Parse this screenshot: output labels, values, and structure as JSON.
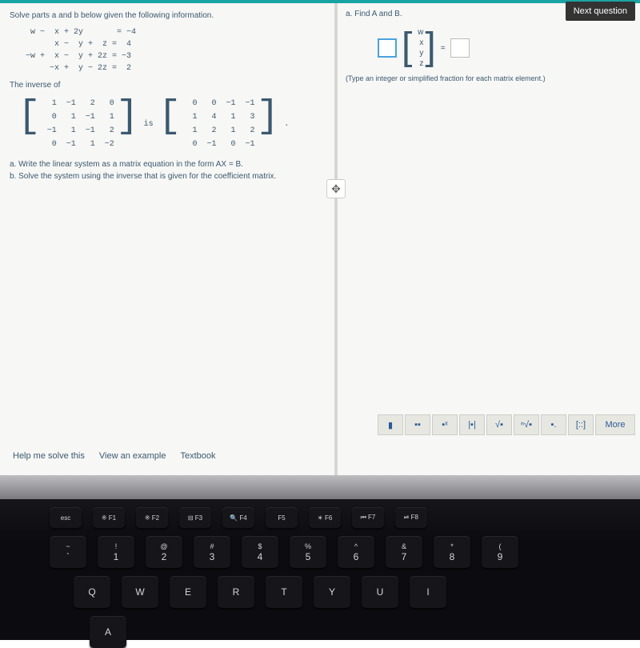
{
  "header": {
    "next": "Next question"
  },
  "left": {
    "intro": "Solve parts a and b below given the following information.",
    "equations": " w −  x + 2y       = −4\n      x −  y +  z =  4\n−w +  x −  y + 2z = −3\n     −x +  y − 2z =  2",
    "inverse_label": "The inverse of",
    "is_label": "is",
    "matrixA": [
      [
        "1",
        "−1",
        "2",
        "0"
      ],
      [
        "0",
        "1",
        "−1",
        "1"
      ],
      [
        "−1",
        "1",
        "−1",
        "2"
      ],
      [
        "0",
        "−1",
        "1",
        "−2"
      ]
    ],
    "matrixB": [
      [
        "0",
        "0",
        "−1",
        "−1"
      ],
      [
        "1",
        "4",
        "1",
        "3"
      ],
      [
        "1",
        "2",
        "1",
        "2"
      ],
      [
        "0",
        "−1",
        "0",
        "−1"
      ]
    ],
    "qa": "a. Write the linear system as a matrix equation in the form AX = B.",
    "qb": "b. Solve the system using the inverse that is given for the coefficient matrix."
  },
  "right": {
    "title": "a. Find A and B.",
    "vector": [
      "w",
      "x",
      "y",
      "z"
    ],
    "equals": "=",
    "hint": "(Type an integer or simplified fraction for each matrix element.)"
  },
  "toolbar": {
    "items": [
      "▮",
      "▪▪",
      "▪ˣ",
      "|▪|",
      "√▪",
      "ⁿ√▪",
      "▪.",
      "[::]"
    ],
    "more": "More"
  },
  "footer": {
    "help": "Help me solve this",
    "example": "View an example",
    "textbook": "Textbook"
  },
  "keyboard": {
    "fn": [
      "esc",
      "※\nF1",
      "※\nF2",
      "⊟\nF3",
      "🔍\nF4",
      "\nF5",
      "☀\nF6",
      "⏮\nF7",
      "⏯\nF8"
    ],
    "num_upper": [
      "~",
      "!",
      "@",
      "#",
      "$",
      "%",
      "^",
      "&",
      "*",
      "("
    ],
    "num_lower": [
      "`",
      "1",
      "2",
      "3",
      "4",
      "5",
      "6",
      "7",
      "8",
      "9"
    ],
    "letters": [
      "Q",
      "W",
      "E",
      "R",
      "T",
      "Y",
      "U",
      "I"
    ],
    "letters2_start": "A"
  }
}
